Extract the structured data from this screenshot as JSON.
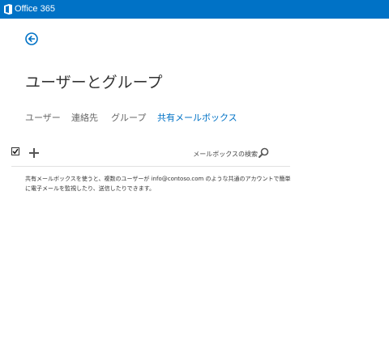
{
  "app": {
    "title": "Office 365",
    "brand_color": "#0072c6"
  },
  "header": {
    "back_icon": "back-arrow-icon"
  },
  "page": {
    "title": "ユーザーとグループ"
  },
  "tabs": [
    {
      "label": "ユーザー",
      "active": false
    },
    {
      "label": "連絡先",
      "active": false
    },
    {
      "label": "グループ",
      "active": false
    },
    {
      "label": "共有メールボックス",
      "active": true
    }
  ],
  "toolbar": {
    "select_all_checked": true,
    "add_icon": "plus-icon",
    "search_placeholder": "メールボックスの検索",
    "search_icon": "search-icon"
  },
  "content": {
    "description": "共有メールボックスを使うと、複数のユーザーが info@contoso.com のような共通のアカウントで簡単に電子メールを監視したり、送信したりできます。"
  }
}
